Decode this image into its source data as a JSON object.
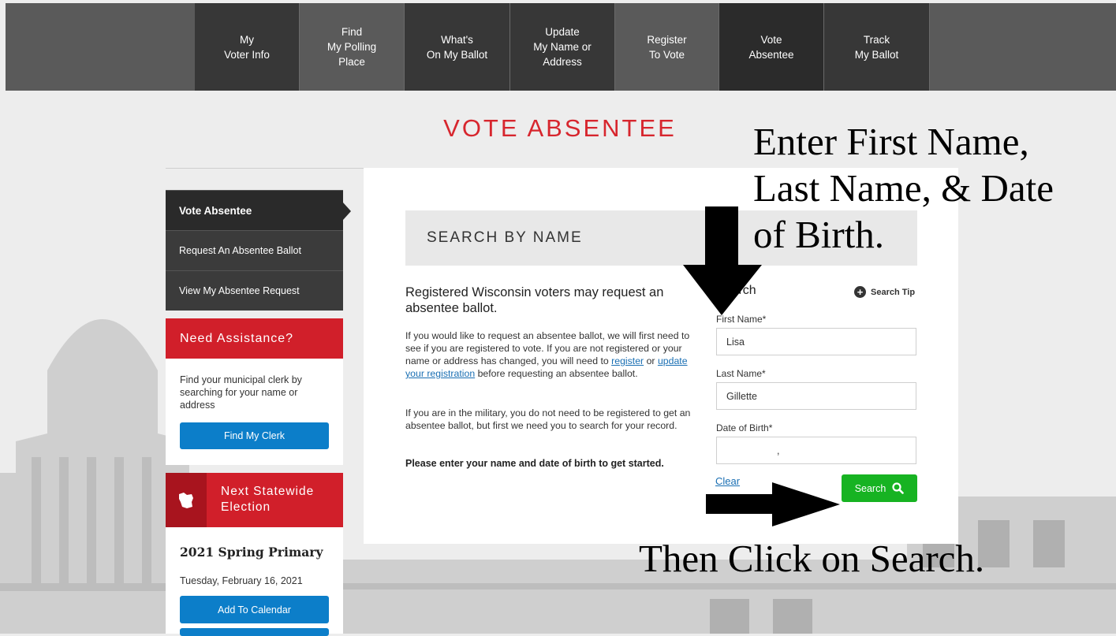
{
  "nav": {
    "items": [
      {
        "label": "My\nVoter Info",
        "state": "dark"
      },
      {
        "label": "Find\nMy Polling\nPlace",
        "state": "normal"
      },
      {
        "label": "What's\nOn My Ballot",
        "state": "dark"
      },
      {
        "label": "Update\nMy Name or\nAddress",
        "state": "dark"
      },
      {
        "label": "Register\nTo Vote",
        "state": "normal"
      },
      {
        "label": "Vote\nAbsentee",
        "state": "active"
      },
      {
        "label": "Track\nMy Ballot",
        "state": "dark"
      }
    ]
  },
  "page_title": "VOTE ABSENTEE",
  "sidebar": {
    "items": [
      {
        "label": "Vote Absentee"
      },
      {
        "label": "Request An Absentee Ballot"
      },
      {
        "label": "View My Absentee Request"
      }
    ],
    "assistance": {
      "title": "Need Assistance?",
      "text": "Find your municipal clerk by searching for your name or address",
      "button": "Find My Clerk"
    },
    "election": {
      "title": "Next Statewide\nElection",
      "name": "2021 Spring Primary",
      "date": "Tuesday, February 16, 2021",
      "button": "Add To Calendar"
    }
  },
  "main": {
    "band_title": "SEARCH BY NAME",
    "intro_heading": "Registered Wisconsin voters may request an absentee ballot.",
    "p1_before": "If you would like to request an absentee ballot, we will first need to see if you are registered to vote. If you are not registered or your name or address has changed, you will need to ",
    "p1_link1": "register",
    "p1_mid": " or ",
    "p1_link2": "update your registration",
    "p1_after": " before requesting an absentee ballot.",
    "p2": "If you are in the military, you do not need to be registered to get an absentee ballot, but first we need you to search for your record.",
    "bold_line": "Please enter your name and date of birth to get started."
  },
  "form": {
    "heading": "Search",
    "tip": "Search Tip",
    "first_name_label": "First Name*",
    "first_name_value": "Lisa",
    "last_name_label": "Last Name*",
    "last_name_value": "Gillette",
    "dob_label": "Date of Birth*",
    "dob_value": ",",
    "clear": "Clear",
    "search_button": "Search"
  },
  "annotations": {
    "top": "Enter First Name,\nLast Name, & Date\nof Birth.",
    "bottom": "Then Click on Search."
  },
  "colors": {
    "brand_red": "#d11f2a",
    "title_red": "#d7262e",
    "nav_bg": "#5a5a5a",
    "button_blue": "#0c7ec9",
    "search_green": "#17b322"
  }
}
